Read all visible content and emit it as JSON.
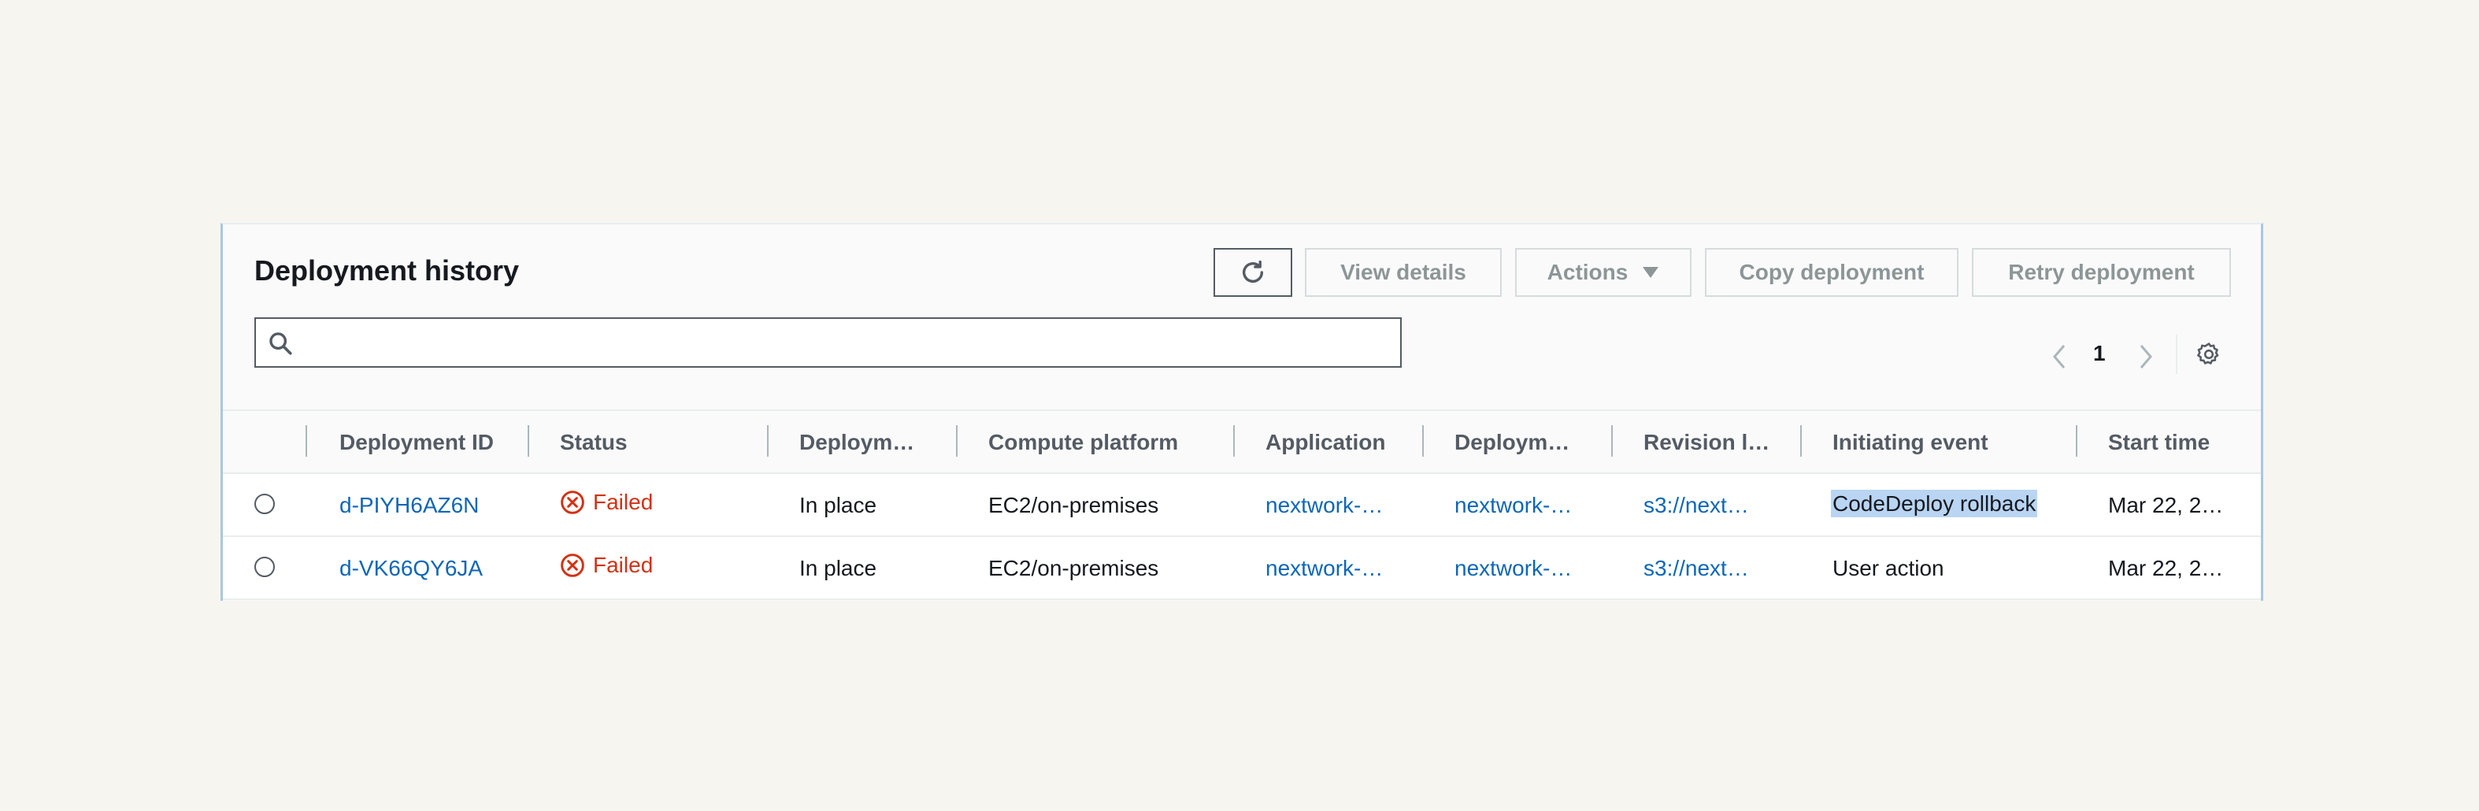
{
  "panel": {
    "title": "Deployment history",
    "buttons": {
      "refresh_icon": "refresh-icon",
      "view_details": "View details",
      "actions": "Actions",
      "copy_deployment": "Copy deployment",
      "retry_deployment": "Retry deployment"
    },
    "search": {
      "placeholder": "",
      "value": ""
    },
    "pagination": {
      "current_page": "1"
    }
  },
  "table": {
    "columns": [
      "Deployment ID",
      "Status",
      "Deploym…",
      "Compute platform",
      "Application",
      "Deploym…",
      "Revision l…",
      "Initiating event",
      "Start time"
    ],
    "rows": [
      {
        "id": "d-PIYH6AZ6N",
        "status": "Failed",
        "deployment_type": "In place",
        "compute_platform": "EC2/on-premises",
        "application": "nextwork-…",
        "deployment_group": "nextwork-…",
        "revision_location": "s3://next…",
        "initiating_event": "CodeDeploy rollback",
        "start_time": "Mar 22, 2…"
      },
      {
        "id": "d-VK66QY6JA",
        "status": "Failed",
        "deployment_type": "In place",
        "compute_platform": "EC2/on-premises",
        "application": "nextwork-…",
        "deployment_group": "nextwork-…",
        "revision_location": "s3://next…",
        "initiating_event": "User action",
        "start_time": "Mar 22, 2…"
      }
    ]
  },
  "colors": {
    "link": "#0f66b8",
    "failed": "#d13212",
    "selection_highlight": "#b9d5f3"
  }
}
